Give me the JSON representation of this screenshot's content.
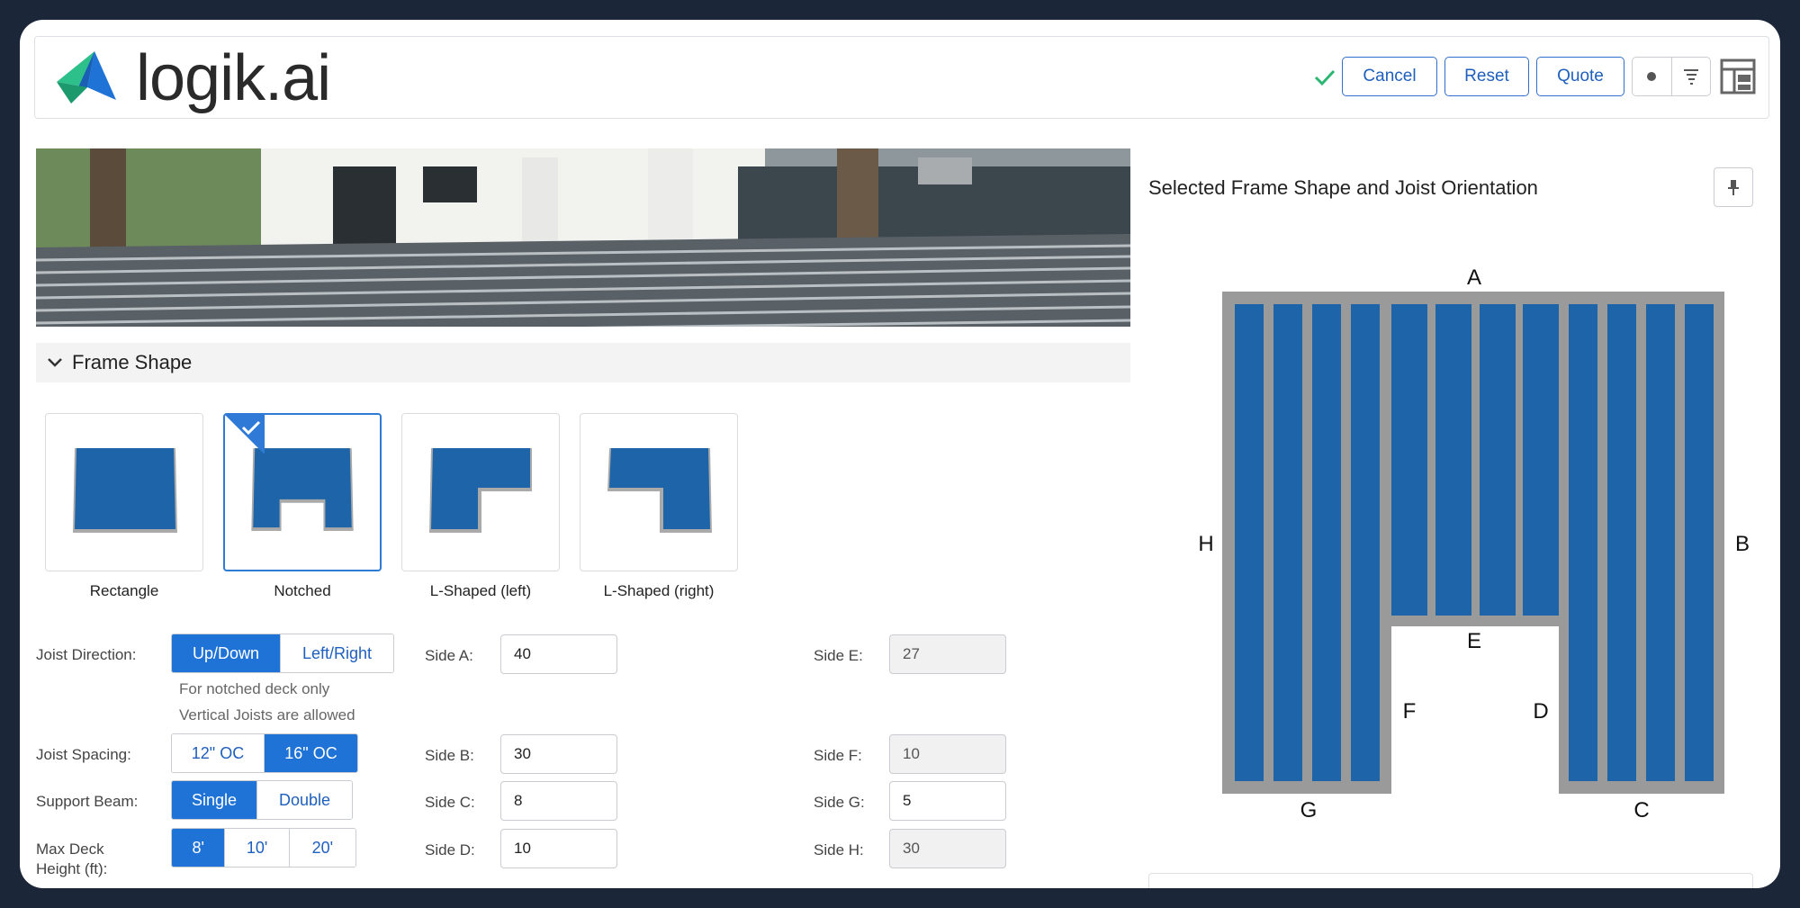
{
  "app": {
    "brand": "logik.ai",
    "brand_color": "#1f72d6"
  },
  "header": {
    "status_icon": "check-icon",
    "buttons": {
      "cancel": "Cancel",
      "reset": "Reset",
      "quote": "Quote"
    },
    "icons": [
      "dot-icon",
      "filter-lines-icon",
      "layout-icon"
    ]
  },
  "section": {
    "title": "Frame Shape"
  },
  "shapes": [
    {
      "label": "Rectangle",
      "selected": false
    },
    {
      "label": "Notched",
      "selected": true
    },
    {
      "label": "L-Shaped (left)",
      "selected": false
    },
    {
      "label": "L-Shaped (right)",
      "selected": false
    }
  ],
  "form": {
    "joist_direction": {
      "label": "Joist Direction:",
      "options": [
        "Up/Down",
        "Left/Right"
      ],
      "selected": "Up/Down",
      "note1": "For notched deck only",
      "note2": "Vertical Joists are allowed"
    },
    "joist_spacing": {
      "label": "Joist Spacing:",
      "options": [
        "12\" OC",
        "16\" OC"
      ],
      "selected": "16\" OC"
    },
    "support_beam": {
      "label": "Support Beam:",
      "options": [
        "Single",
        "Double"
      ],
      "selected": "Single"
    },
    "max_height": {
      "label1": "Max Deck",
      "label2": "Height (ft):",
      "options": [
        "8'",
        "10'",
        "20'"
      ],
      "selected": "8'"
    },
    "sides": {
      "a": {
        "label": "Side A:",
        "value": "40"
      },
      "b": {
        "label": "Side B:",
        "value": "30"
      },
      "c": {
        "label": "Side C:",
        "value": "8"
      },
      "d": {
        "label": "Side D:",
        "value": "10"
      },
      "e": {
        "label": "Side E:",
        "value": "27"
      },
      "f": {
        "label": "Side F:",
        "value": "10"
      },
      "g": {
        "label": "Side G:",
        "value": "5"
      },
      "h": {
        "label": "Side H:",
        "value": "30"
      }
    }
  },
  "panel": {
    "title": "Selected Frame Shape and Joist Orientation",
    "pin_icon": "pin-icon",
    "diagram_labels": {
      "a": "A",
      "b": "B",
      "c": "C",
      "d": "D",
      "e": "E",
      "f": "F",
      "g": "G",
      "h": "H"
    },
    "joist_color": "#1d64a8",
    "frame_color": "#9a9a9a"
  }
}
